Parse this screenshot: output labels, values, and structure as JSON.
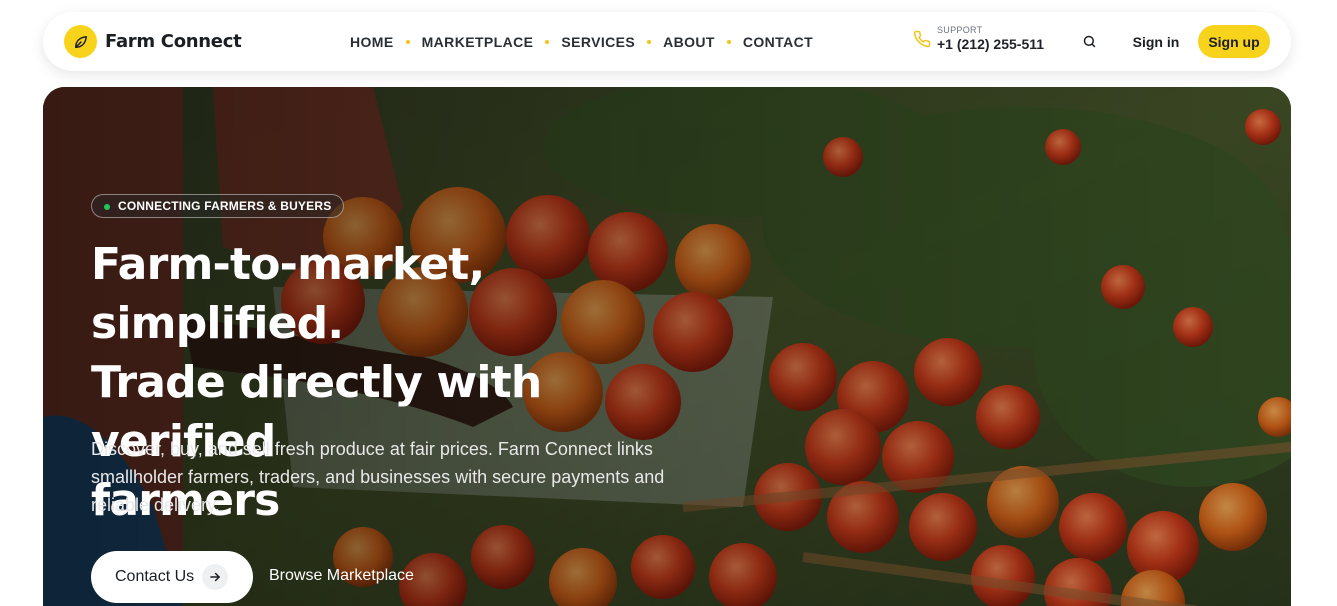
{
  "brand": {
    "name": "Farm Connect",
    "logo_icon": "leaf-icon",
    "accent_color": "#f7d31c"
  },
  "nav": {
    "items": [
      {
        "label": "HOME"
      },
      {
        "label": "MARKETPLACE"
      },
      {
        "label": "SERVICES"
      },
      {
        "label": "ABOUT"
      },
      {
        "label": "CONTACT"
      }
    ]
  },
  "support": {
    "label": "SUPPORT",
    "phone": "+1 (212) 255-511",
    "icon": "phone-icon"
  },
  "header_actions": {
    "search_icon": "search-icon",
    "signin_label": "Sign in",
    "signup_label": "Sign up"
  },
  "hero": {
    "badge": "CONNECTING FARMERS & BUYERS",
    "title_lines": [
      "Farm-to-market, simplified.",
      "Trade directly with verified",
      "farmers"
    ],
    "description": "Discover, buy, and sell fresh produce at fair prices. Farm Connect links smallholder farmers, traders, and businesses with secure payments and reliable delivery.",
    "primary_cta": "Contact Us",
    "primary_cta_icon": "arrow-right-icon",
    "secondary_cta": "Browse Marketplace",
    "status_dot_color": "#22c55e"
  }
}
